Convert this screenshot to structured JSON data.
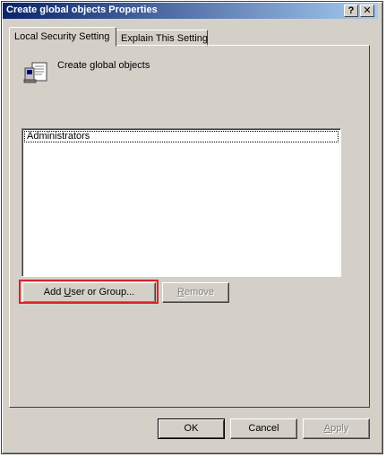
{
  "window": {
    "title": "Create global objects Properties",
    "help_button": "?",
    "close_button": "✕"
  },
  "tabs": [
    {
      "label": "Local Security Setting",
      "active": true
    },
    {
      "label": "Explain This Setting",
      "active": false
    }
  ],
  "policy": {
    "icon": "security-policy-icon",
    "name": "Create global objects"
  },
  "principals": {
    "items": [
      "Administrators"
    ]
  },
  "actions": {
    "add_pre": "Add ",
    "add_hotkey": "U",
    "add_post": "ser or Group...",
    "remove_hotkey": "R",
    "remove_post": "emove",
    "remove_enabled": false,
    "highlight_color": "#d9232a"
  },
  "footer": {
    "ok": "OK",
    "cancel": "Cancel",
    "apply_hotkey": "A",
    "apply_post": "pply",
    "apply_enabled": false
  }
}
